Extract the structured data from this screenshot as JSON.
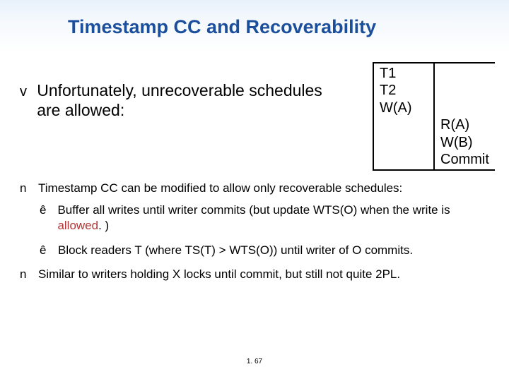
{
  "title": "Timestamp CC and Recoverability",
  "main": {
    "bullet": "v",
    "text": "Unfortunately, unrecoverable schedules are allowed:"
  },
  "schedule": {
    "h1": " T1",
    "h2": "T2",
    "c1a": "W(A)",
    "c2a": "R(A)",
    "c2b": "W(B)",
    "c2c": "Commit"
  },
  "points": {
    "n1": "n",
    "p1": "Timestamp CC can be modified to allow only recoverable schedules:",
    "eb": "ê",
    "s1a": "Buffer all writes until writer commits (but update WTS(O) when the write is ",
    "s1b": "allowed",
    "s1c": ". )",
    "s2": "Block readers T (where TS(T) > WTS(O)) until writer of O commits.",
    "p2": "Similar to writers holding X locks until commit, but still not quite 2PL."
  },
  "pagenum": "1. 67"
}
